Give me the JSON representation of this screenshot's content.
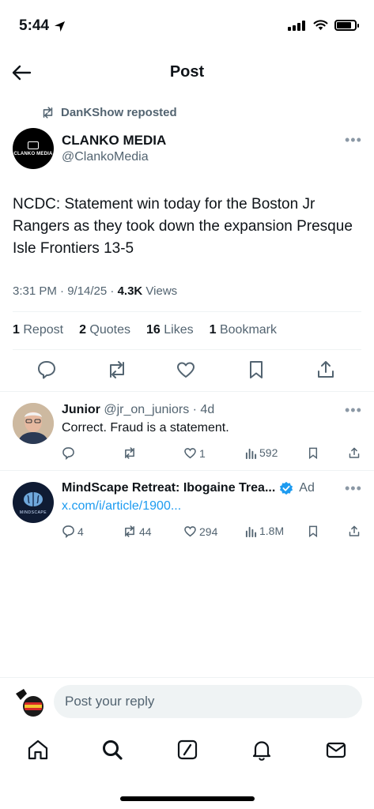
{
  "status_bar": {
    "time": "5:44"
  },
  "header": {
    "title": "Post"
  },
  "repost": {
    "text": "DanKShow reposted"
  },
  "post": {
    "author_name": "CLANKO MEDIA",
    "author_handle": "@ClankoMedia",
    "avatar_text": "CLANKO MEDIA",
    "text": "NCDC: Statement win today for the Boston Jr Rangers as they took down the expansion Presque Isle Frontiers 13-5",
    "time": "3:31 PM · 9/14/25 · ",
    "views_count": "4.3K",
    "views_label": " Views",
    "stats": {
      "reposts_count": "1",
      "reposts_label": "Repost",
      "quotes_count": "2",
      "quotes_label": "Quotes",
      "likes_count": "16",
      "likes_label": "Likes",
      "bookmarks_count": "1",
      "bookmarks_label": "Bookmark"
    }
  },
  "replies": [
    {
      "name": "Junior",
      "handle": "@jr_on_juniors · 4d",
      "text": "Correct. Fraud is a statement.",
      "likes": "1",
      "views": "592"
    },
    {
      "name": "MindScape Retreat: Ibogaine Trea...",
      "ad_label": "Ad",
      "link": "x.com/i/article/1900...",
      "replies": "4",
      "reposts": "44",
      "likes": "294",
      "views": "1.8M",
      "avatar_text": "MINDSCAPE"
    }
  ],
  "reply_box": {
    "placeholder": "Post your reply"
  },
  "colors": {
    "accent": "#1d9bf0",
    "secondary_text": "#536471",
    "divider": "#eff3f4"
  }
}
